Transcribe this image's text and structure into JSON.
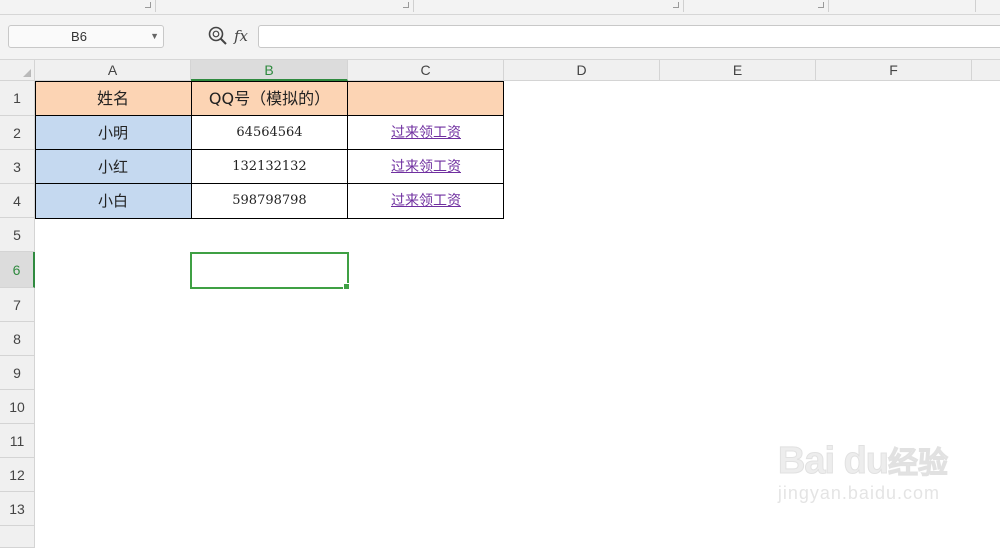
{
  "formula_bar": {
    "name_box": "B6",
    "fx_label": "fx",
    "formula_value": ""
  },
  "columns": [
    "A",
    "B",
    "C",
    "D",
    "E",
    "F"
  ],
  "rows": [
    "1",
    "2",
    "3",
    "4",
    "5",
    "6",
    "7",
    "8",
    "9",
    "10",
    "11",
    "12",
    "13"
  ],
  "active_cell": "B6",
  "table": {
    "headers": [
      "姓名",
      "QQ号（模拟的）",
      ""
    ],
    "rows": [
      {
        "name": "小明",
        "qq": "64564564",
        "link": "过来领工资"
      },
      {
        "name": "小红",
        "qq": "132132132",
        "link": "过来领工资"
      },
      {
        "name": "小白",
        "qq": "598798798",
        "link": "过来领工资"
      }
    ]
  },
  "colors": {
    "header_fill": "#fcd4b4",
    "name_fill": "#c5d9f0",
    "link_color": "#7030a0",
    "selection": "#3fa044"
  },
  "watermark": {
    "logo": "Bai du",
    "cn": "经验",
    "sub": "jingyan.baidu.com"
  }
}
